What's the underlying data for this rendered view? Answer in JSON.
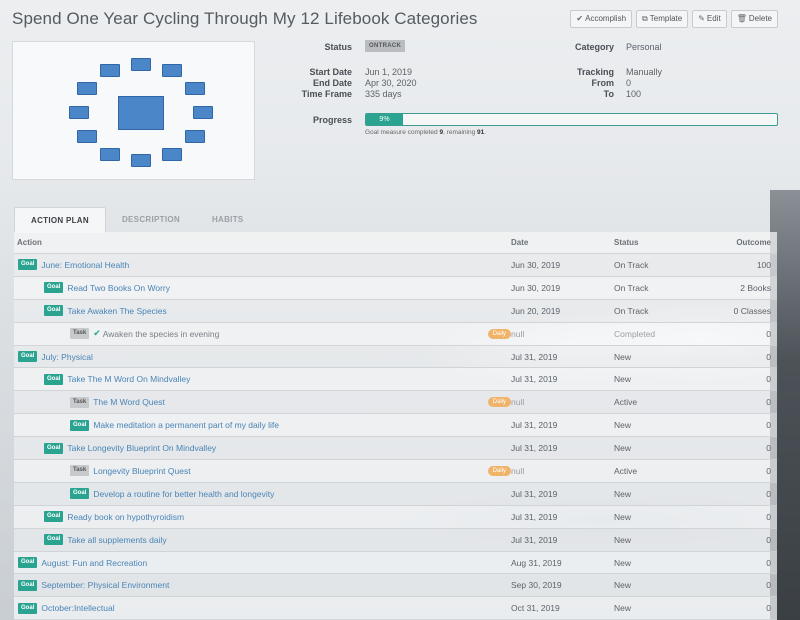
{
  "page": {
    "title": "Spend One Year Cycling Through My 12 Lifebook Categories"
  },
  "actions": [
    {
      "icon": "check-icon",
      "glyph": "✔",
      "label": "Accomplish"
    },
    {
      "icon": "template-icon",
      "glyph": "⧉",
      "label": "Template"
    },
    {
      "icon": "pencil-icon",
      "glyph": "✎",
      "label": "Edit"
    },
    {
      "icon": "trash-icon",
      "glyph": "🗑",
      "label": "Delete"
    }
  ],
  "info": {
    "status_label": "Status",
    "status_value": "ONTRACK",
    "start_label": "Start Date",
    "start_value": "Jun 1, 2019",
    "end_label": "End Date",
    "end_value": "Apr 30, 2020",
    "timeframe_label": "Time Frame",
    "timeframe_value": "335 days",
    "category_label": "Category",
    "category_value": "Personal",
    "tracking_label": "Tracking",
    "tracking_value": "Manually",
    "from_label": "From",
    "from_value": "0",
    "to_label": "To",
    "to_value": "100",
    "progress_label": "Progress",
    "progress_text": "9%",
    "progress_fraction": 0.09,
    "progress_note_pre": "Goal measure completed",
    "progress_completed": "9",
    "progress_note_mid": ", remaining",
    "progress_remaining": "91",
    "progress_note_end": "."
  },
  "tabs": [
    "ACTION PLAN",
    "DESCRIPTION",
    "HABITS"
  ],
  "table": {
    "headers": {
      "action": "Action",
      "date": "Date",
      "status": "Status",
      "outcome": "Outcome"
    },
    "rows": [
      {
        "level": 0,
        "type": "Goal",
        "title": "June: Emotional Health",
        "date": "Jun 30, 2019",
        "status": "On Track",
        "outcome": "100"
      },
      {
        "level": 1,
        "type": "Goal",
        "title": "Read Two Books On Worry",
        "date": "Jun 30, 2019",
        "status": "On Track",
        "outcome": "2 Books"
      },
      {
        "level": 1,
        "type": "Goal",
        "title": "Take Awaken The Species",
        "date": "Jun 20, 2019",
        "status": "On Track",
        "outcome": "0 Classes"
      },
      {
        "level": 2,
        "type": "Task",
        "title": "Awaken the species in evening",
        "done": true,
        "freq": "Daily",
        "date": "null",
        "status": "Completed",
        "outcome": "0"
      },
      {
        "level": 0,
        "type": "Goal",
        "title": "July: Physical",
        "date": "Jul 31, 2019",
        "status": "New",
        "outcome": "0"
      },
      {
        "level": 1,
        "type": "Goal",
        "title": "Take The M Word On Mindvalley",
        "date": "Jul 31, 2019",
        "status": "New",
        "outcome": "0"
      },
      {
        "level": 2,
        "type": "Task",
        "title": "The M Word Quest",
        "freq": "Daily",
        "date": "null",
        "status": "Active",
        "outcome": "0"
      },
      {
        "level": 2,
        "type": "Goal",
        "title": "Make meditation a permanent part of my daily life",
        "date": "Jul 31, 2019",
        "status": "New",
        "outcome": "0"
      },
      {
        "level": 1,
        "type": "Goal",
        "title": "Take Longevity Blueprint On Mindvalley",
        "date": "Jul 31, 2019",
        "status": "New",
        "outcome": "0"
      },
      {
        "level": 2,
        "type": "Task",
        "title": "Longevity Blueprint Quest",
        "freq": "Daily",
        "date": "null",
        "status": "Active",
        "outcome": "0"
      },
      {
        "level": 2,
        "type": "Goal",
        "title": "Develop a routine for better health and longevity",
        "date": "Jul 31, 2019",
        "status": "New",
        "outcome": "0"
      },
      {
        "level": 1,
        "type": "Goal",
        "title": "Ready book on hypothyroidism",
        "date": "Jul 31, 2019",
        "status": "New",
        "outcome": "0"
      },
      {
        "level": 1,
        "type": "Goal",
        "title": "Take all supplements daily",
        "date": "Jul 31, 2019",
        "status": "New",
        "outcome": "0"
      },
      {
        "level": 0,
        "type": "Goal",
        "title": "August: Fun and Recreation",
        "date": "Aug 31, 2019",
        "status": "New",
        "outcome": "0"
      },
      {
        "level": 0,
        "type": "Goal",
        "title": "September: Physical Environment",
        "date": "Sep 30, 2019",
        "status": "New",
        "outcome": "0"
      },
      {
        "level": 0,
        "type": "Goal",
        "title": "October:Intellectual",
        "date": "Oct 31, 2019",
        "status": "New",
        "outcome": "0"
      }
    ]
  },
  "colors": {
    "goal": "#2aa390",
    "task": "#c7cacd",
    "daily": "#f0b36a",
    "link": "#4a85b6"
  }
}
